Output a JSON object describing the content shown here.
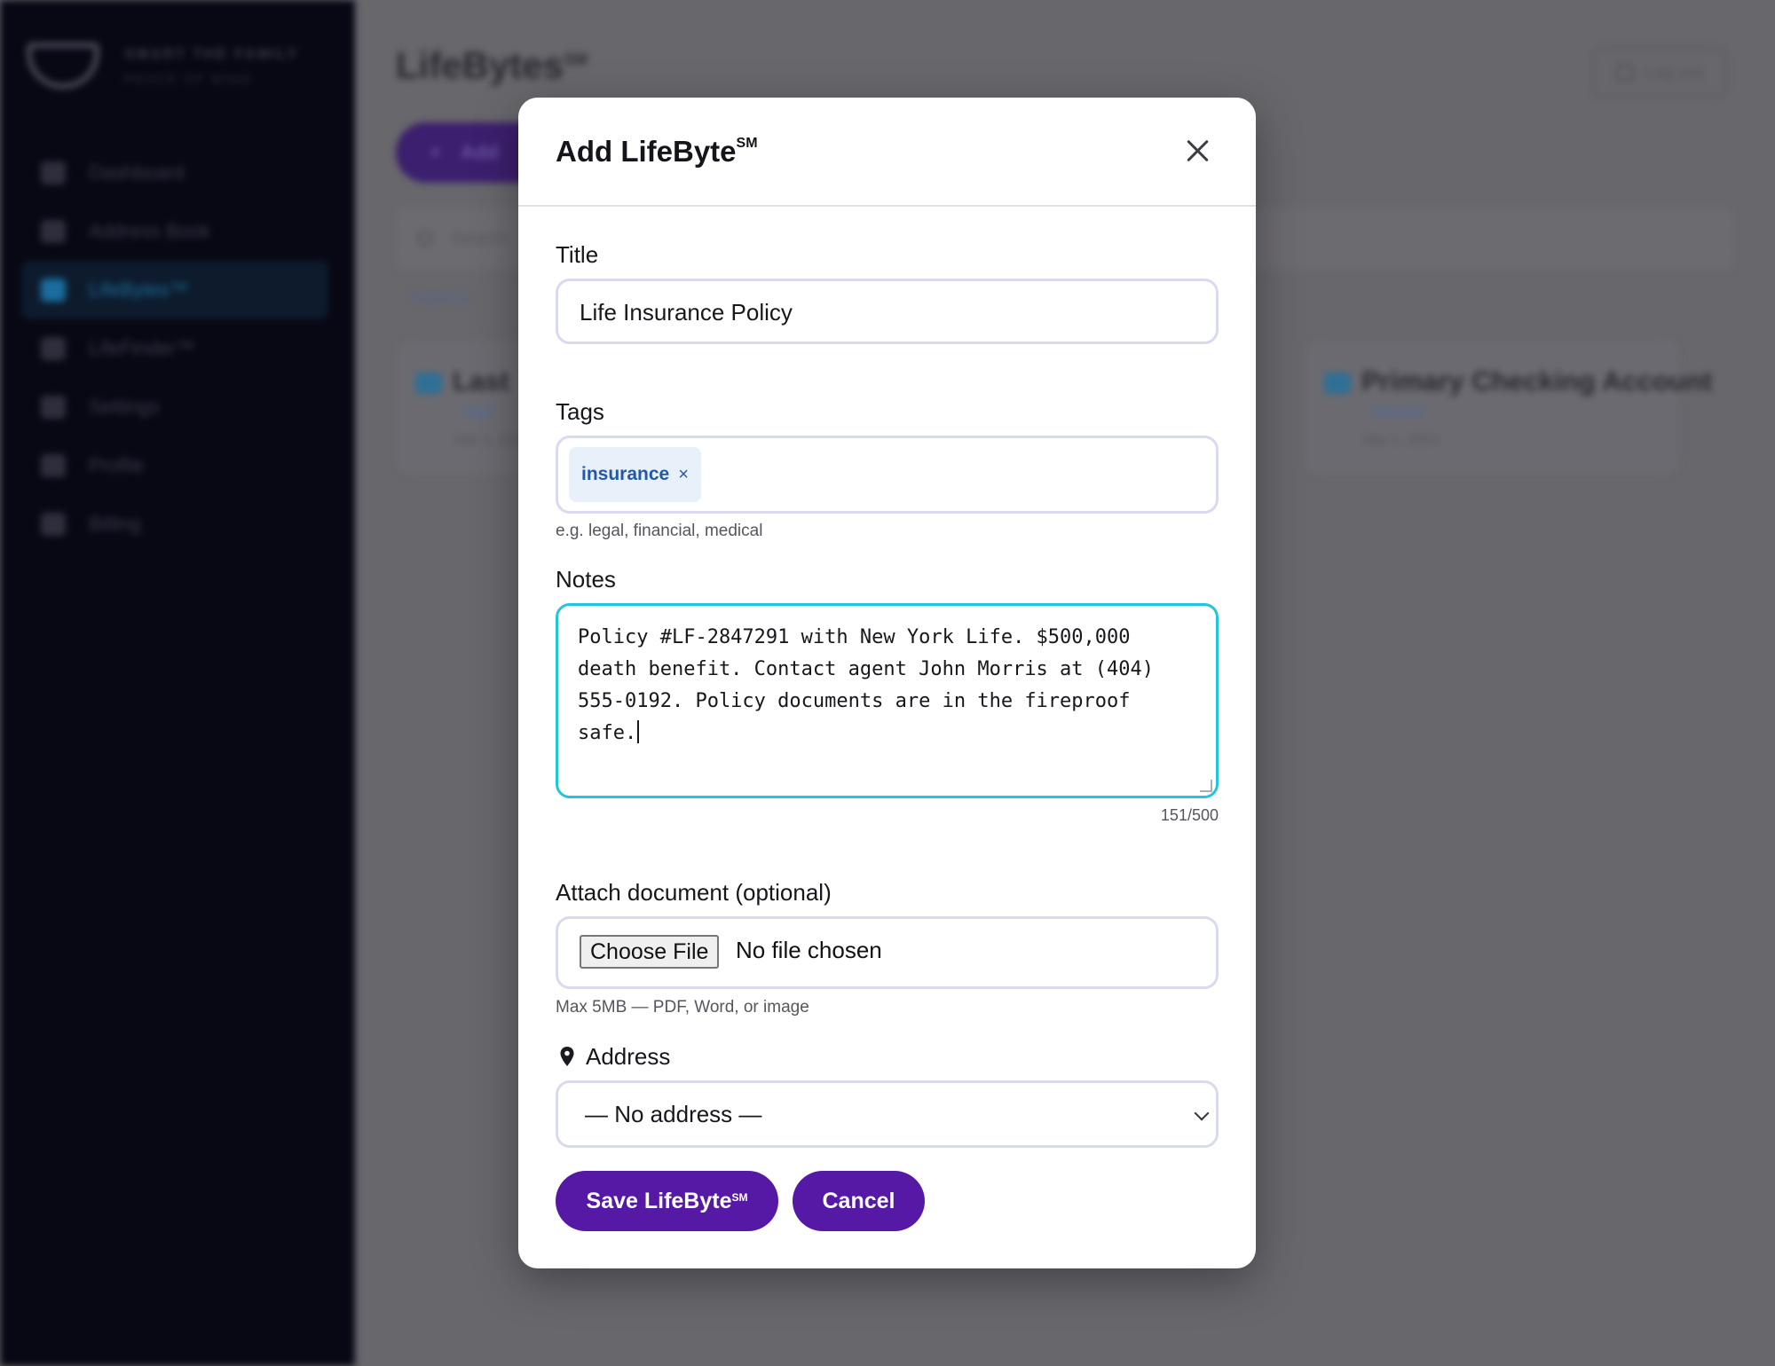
{
  "background": {
    "brand": {
      "line1": "SMART THE FAMILY",
      "line2": "PEACE OF MIND"
    },
    "nav": [
      {
        "label": "Dashboard"
      },
      {
        "label": "Address Book"
      },
      {
        "label": "LifeBytes™",
        "active": true
      },
      {
        "label": "LifeFinder™"
      },
      {
        "label": "Settings"
      },
      {
        "label": "Profile"
      },
      {
        "label": "Billing"
      }
    ],
    "page_title": "LifeBytes",
    "page_title_sup": "SM",
    "logout_label": "Log out",
    "add_button_label": "Add",
    "search_placeholder": "Search",
    "filter_label": "financial",
    "cards": [
      {
        "title": "Last",
        "tag": "legal",
        "date": "Mar 1, 2024"
      },
      {
        "title": "Primary Checking Account",
        "tag": "financial",
        "date": "Mar 1, 2024"
      }
    ]
  },
  "modal": {
    "title": "Add LifeByte",
    "title_sup": "SM",
    "title_field": {
      "label": "Title",
      "value": "Life Insurance Policy"
    },
    "tags_field": {
      "label": "Tags",
      "tags": [
        "insurance"
      ],
      "remove_symbol": "×",
      "help": "e.g. legal, financial, medical"
    },
    "notes_field": {
      "label": "Notes",
      "value": "Policy #LF-2847291 with New York Life. $500,000\ndeath benefit. Contact agent John Morris at (404)\n555-0192. Policy documents are in the fireproof\nsafe.",
      "counter": "151/500"
    },
    "attach_field": {
      "label": "Attach document (optional)",
      "button": "Choose File",
      "status": "No file chosen",
      "help": "Max 5MB — PDF, Word, or image"
    },
    "address_field": {
      "label": "Address",
      "icon": "map-pin-icon",
      "selected": "— No address —"
    },
    "save_button": {
      "label": "Save LifeByte",
      "sup": "SM"
    },
    "cancel_button": {
      "label": "Cancel"
    }
  },
  "colors": {
    "primary": "#5519a5",
    "focus": "#23c4dc",
    "tag_bg": "#e8f0fa",
    "tag_text": "#2357a8",
    "overlay": "#68676c"
  }
}
